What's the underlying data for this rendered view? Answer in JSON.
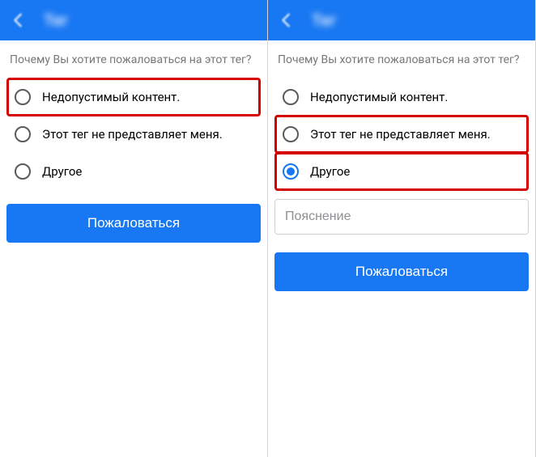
{
  "header": {
    "title": "Тег"
  },
  "question": "Почему Вы хотите пожаловаться на этот тег?",
  "options": {
    "inappropriate": "Недопустимый контент.",
    "not_me": "Этот тег не представляет меня.",
    "other": "Другое"
  },
  "explanation_placeholder": "Пояснение",
  "submit_label": "Пожаловаться",
  "colors": {
    "brand": "#1877f2",
    "highlight": "#d40000"
  }
}
